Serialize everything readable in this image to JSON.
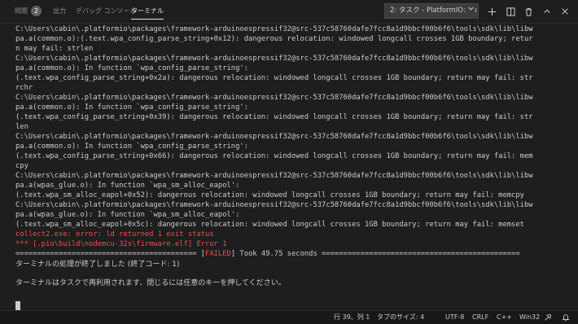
{
  "panel_tabs": [
    {
      "label": "問題",
      "badge": "2"
    },
    {
      "label": "出力"
    },
    {
      "label": "デバッグ コンソール"
    },
    {
      "label": "ターミナル"
    }
  ],
  "task_selector": {
    "value": "2: タスク - PlatformIO: Bu"
  },
  "toolbar_icons": [
    "chevron-down-icon",
    "add-terminal-icon",
    "split-terminal-icon",
    "trash-icon",
    "maximize-panel-icon",
    "close-panel-icon"
  ],
  "terminal": {
    "lines": [
      "C:\\Users\\cabin\\.platformio\\packages\\framework-arduinoespressif32@src-537c58760dafe7fcc8a1d9bbcf00b6f6\\tools\\sdk\\lib\\libw",
      "pa.a(common.o):(.text.wpa_config_parse_string+0x12): dangerous relocation: windowed longcall crosses 1GB boundary; retur",
      "n may fail: strlen",
      "C:\\Users\\cabin\\.platformio\\packages\\framework-arduinoespressif32@src-537c58760dafe7fcc8a1d9bbcf00b6f6\\tools\\sdk\\lib\\libw",
      "pa.a(common.o): In function `wpa_config_parse_string':",
      "(.text.wpa_config_parse_string+0x2a): dangerous relocation: windowed longcall crosses 1GB boundary; return may fail: str",
      "rchr",
      "C:\\Users\\cabin\\.platformio\\packages\\framework-arduinoespressif32@src-537c58760dafe7fcc8a1d9bbcf00b6f6\\tools\\sdk\\lib\\libw",
      "pa.a(common.o): In function `wpa_config_parse_string':",
      "(.text.wpa_config_parse_string+0x39): dangerous relocation: windowed longcall crosses 1GB boundary; return may fail: str",
      "len",
      "C:\\Users\\cabin\\.platformio\\packages\\framework-arduinoespressif32@src-537c58760dafe7fcc8a1d9bbcf00b6f6\\tools\\sdk\\lib\\libw",
      "pa.a(common.o): In function `wpa_config_parse_string':",
      "(.text.wpa_config_parse_string+0x66): dangerous relocation: windowed longcall crosses 1GB boundary; return may fail: mem",
      "cpy",
      "C:\\Users\\cabin\\.platformio\\packages\\framework-arduinoespressif32@src-537c58760dafe7fcc8a1d9bbcf00b6f6\\tools\\sdk\\lib\\libw",
      "pa.a(wpas_glue.o): In function `wpa_sm_alloc_eapol':",
      "(.text.wpa_sm_alloc_eapol+0x52): dangerous relocation: windowed longcall crosses 1GB boundary; return may fail: memcpy",
      "C:\\Users\\cabin\\.platformio\\packages\\framework-arduinoespressif32@src-537c58760dafe7fcc8a1d9bbcf00b6f6\\tools\\sdk\\lib\\libw",
      "pa.a(wpas_glue.o): In function `wpa_sm_alloc_eapol':",
      "(.text.wpa_sm_alloc_eapol+0x5c): dangerous relocation: windowed longcall crosses 1GB boundary; return may fail: memset"
    ],
    "error_lines": [
      "collect2.exe: error: ld returned 1 exit status",
      "*** [.pio\\build\\nodemcu-32s\\firmware.elf] Error 1"
    ],
    "summary": {
      "left_rule": "========================================== [",
      "status": "FAILED",
      "right_text": "] Took 49.75 seconds =============================================="
    },
    "process_end": "ターミナルの処理が終了しました (終了コード: 1)",
    "reuse_message": "ターミナルはタスクで再利用されます、閉じるには任意のキーを押してください。"
  },
  "status_bar": {
    "position": "行 39、列 1",
    "tab_size": "タブのサイズ: 4",
    "encoding": "UTF-8",
    "eol": "CRLF",
    "language": "C++",
    "platform": "Win32"
  },
  "colors": {
    "background": "#1e1e1e",
    "error": "#f14c4c",
    "text": "#cccccc"
  }
}
